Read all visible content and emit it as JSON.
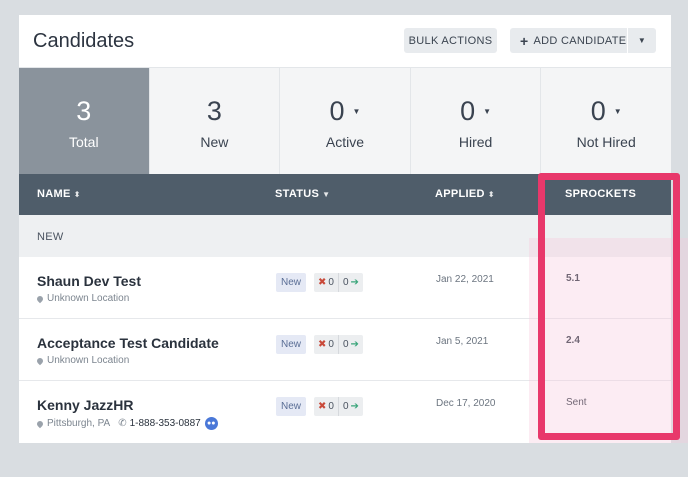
{
  "header": {
    "title": "Candidates",
    "bulk_actions": "BULK ACTIONS",
    "add_candidate": "ADD CANDIDATE"
  },
  "stats": [
    {
      "number": "3",
      "label": "Total",
      "active": true
    },
    {
      "number": "3",
      "label": "New",
      "active": false
    },
    {
      "number": "0",
      "label": "Active",
      "active": false
    },
    {
      "number": "0",
      "label": "Hired",
      "active": false
    },
    {
      "number": "0",
      "label": "Not Hired",
      "active": false
    }
  ],
  "columns": {
    "name": "NAME",
    "status": "STATUS",
    "applied": "APPLIED",
    "sprockets": "SPROCKETS"
  },
  "group": {
    "label": "NEW"
  },
  "candidates": [
    {
      "name": "Shaun Dev Test",
      "location": "Unknown Location",
      "phone": "",
      "status": "New",
      "negative": "0",
      "positive": "0",
      "applied": "Jan 22, 2021",
      "sprockets": "5.1"
    },
    {
      "name": "Acceptance Test Candidate",
      "location": "Unknown Location",
      "phone": "",
      "status": "New",
      "negative": "0",
      "positive": "0",
      "applied": "Jan 5, 2021",
      "sprockets": "2.4"
    },
    {
      "name": "Kenny JazzHR",
      "location": "Pittsburgh, PA",
      "phone": "1-888-353-0887",
      "status": "New",
      "negative": "0",
      "positive": "0",
      "applied": "Dec 17, 2020",
      "sprockets": "Sent"
    }
  ],
  "colors": {
    "highlight": "#e8386b",
    "table_header": "#4f5d6a",
    "active_stat": "#8a939c"
  }
}
